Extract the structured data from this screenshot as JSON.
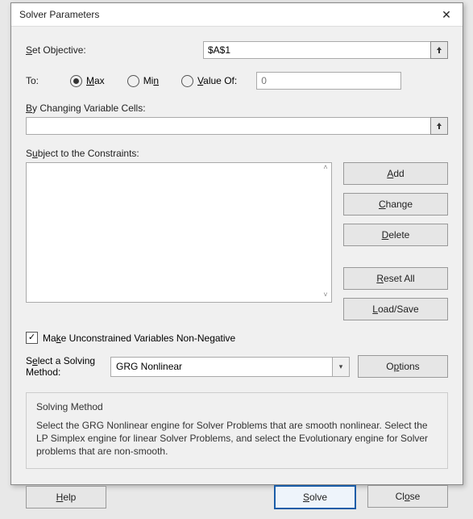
{
  "title": "Solver Parameters",
  "objective": {
    "label": "Set Objective:",
    "value": "$A$1"
  },
  "to": {
    "label": "To:",
    "max": "Max",
    "min": "Min",
    "valueOf": "Value Of:",
    "valueInput": "0"
  },
  "changingCells": {
    "label": "By Changing Variable Cells:",
    "value": ""
  },
  "constraints": {
    "label": "Subject to the Constraints:",
    "buttons": {
      "add": "Add",
      "change": "Change",
      "delete": "Delete",
      "resetAll": "Reset All",
      "loadSave": "Load/Save"
    }
  },
  "nonNegative": {
    "label": "Make Unconstrained Variables Non-Negative",
    "checked": true
  },
  "solvingMethod": {
    "label": "Select a Solving Method:",
    "selected": "GRG Nonlinear",
    "optionsBtn": "Options"
  },
  "info": {
    "title": "Solving Method",
    "body": "Select the GRG Nonlinear engine for Solver Problems that are smooth nonlinear. Select the LP Simplex engine for linear Solver Problems, and select the Evolutionary engine for Solver problems that are non-smooth."
  },
  "footer": {
    "help": "Help",
    "solve": "Solve",
    "close": "Close"
  }
}
